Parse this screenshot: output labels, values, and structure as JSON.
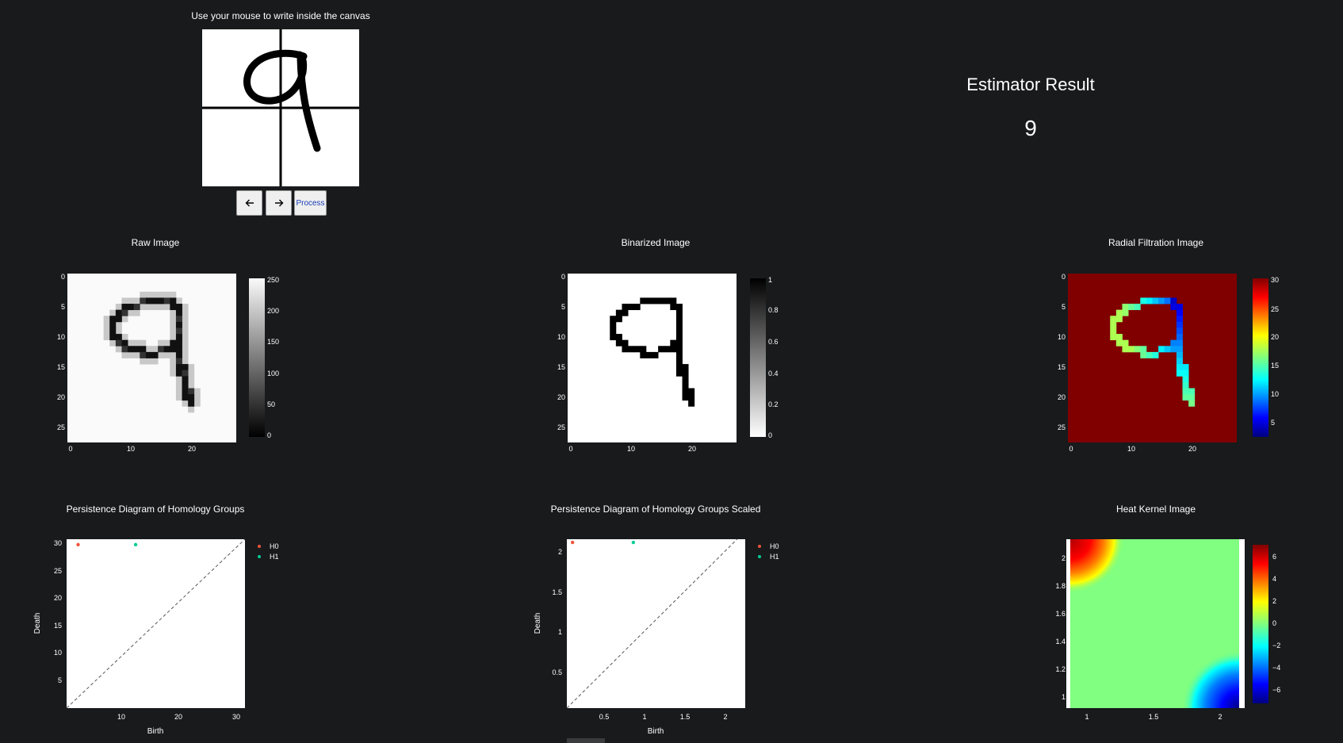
{
  "canvas": {
    "caption": "Use your mouse to write inside the canvas",
    "drawn_digit": "9"
  },
  "controls": {
    "undo_icon": "arrow-left-icon",
    "redo_icon": "arrow-right-icon",
    "process_label": "Process"
  },
  "estimator": {
    "title": "Estimator Result",
    "value": "9"
  },
  "colors": {
    "page_bg": "#181a1c",
    "h0": "#ef553b",
    "h1": "#00cc96",
    "jet_dark_red": "#800000"
  },
  "plots": {
    "raw": {
      "title": "Raw Image",
      "x_ticks": [
        "0",
        "10",
        "20"
      ],
      "y_ticks": [
        "0",
        "5",
        "10",
        "15",
        "20",
        "25"
      ],
      "colorbar_ticks": [
        "250",
        "200",
        "150",
        "100",
        "50",
        "0"
      ]
    },
    "binarized": {
      "title": "Binarized Image",
      "x_ticks": [
        "0",
        "10",
        "20"
      ],
      "y_ticks": [
        "0",
        "5",
        "10",
        "15",
        "20",
        "25"
      ],
      "colorbar_ticks": [
        "1",
        "0.8",
        "0.6",
        "0.4",
        "0.2",
        "0"
      ]
    },
    "radial": {
      "title": "Radial Filtration Image",
      "x_ticks": [
        "0",
        "10",
        "20"
      ],
      "y_ticks": [
        "0",
        "5",
        "10",
        "15",
        "20",
        "25"
      ],
      "colorbar_ticks": [
        "30",
        "25",
        "20",
        "15",
        "10",
        "5"
      ]
    },
    "persistence": {
      "title": "Persistence Diagram of Homology Groups",
      "x_ticks": [
        "10",
        "20",
        "30"
      ],
      "y_ticks": [
        "30",
        "25",
        "20",
        "15",
        "10",
        "5"
      ],
      "xlabel": "Birth",
      "ylabel": "Death",
      "legend": [
        "H0",
        "H1"
      ]
    },
    "persistence_scaled": {
      "title": "Persistence Diagram of Homology Groups Scaled",
      "x_ticks": [
        "0.5",
        "1",
        "1.5",
        "2"
      ],
      "y_ticks": [
        "2",
        "1.5",
        "1",
        "0.5"
      ],
      "xlabel": "Birth",
      "ylabel": "Death",
      "legend": [
        "H0",
        "H1"
      ]
    },
    "heat": {
      "title": "Heat Kernel Image",
      "x_ticks": [
        "1",
        "1.5",
        "2"
      ],
      "y_ticks": [
        "2",
        "1.8",
        "1.6",
        "1.4",
        "1.2",
        "1"
      ],
      "colorbar_ticks": [
        "6",
        "4",
        "2",
        "0",
        "−2",
        "−4",
        "−6"
      ]
    }
  },
  "chart_data": [
    {
      "type": "heatmap",
      "title": "Raw Image",
      "x_range": [
        0,
        27
      ],
      "y_range": [
        0,
        27
      ],
      "colorscale": "greys",
      "z_range": [
        0,
        255
      ],
      "digit": "9"
    },
    {
      "type": "heatmap",
      "title": "Binarized Image",
      "x_range": [
        0,
        27
      ],
      "y_range": [
        0,
        27
      ],
      "colorscale": "greys",
      "z_range": [
        0,
        1
      ],
      "digit": "9"
    },
    {
      "type": "heatmap",
      "title": "Radial Filtration Image",
      "x_range": [
        0,
        27
      ],
      "y_range": [
        0,
        27
      ],
      "colorscale": "jet",
      "z_range": [
        2,
        30
      ],
      "digit": "9"
    },
    {
      "type": "scatter",
      "title": "Persistence Diagram of Homology Groups",
      "xlabel": "Birth",
      "ylabel": "Death",
      "xlim": [
        0,
        31
      ],
      "ylim": [
        0,
        31
      ],
      "series": [
        {
          "name": "H0",
          "points": [
            [
              2,
              30
            ]
          ]
        },
        {
          "name": "H1",
          "points": [
            [
              12,
              30
            ]
          ]
        }
      ]
    },
    {
      "type": "scatter",
      "title": "Persistence Diagram of Homology Groups Scaled",
      "xlabel": "Birth",
      "ylabel": "Death",
      "xlim": [
        0.08,
        2.28
      ],
      "ylim": [
        0.08,
        2.18
      ],
      "series": [
        {
          "name": "H0",
          "points": [
            [
              0.15,
              2.14
            ]
          ]
        },
        {
          "name": "H1",
          "points": [
            [
              0.9,
              2.14
            ]
          ]
        }
      ]
    },
    {
      "type": "heatmap",
      "title": "Heat Kernel Image",
      "x_range": [
        0.85,
        2.2
      ],
      "y_range": [
        0.88,
        2.14
      ],
      "colorscale": "jet",
      "z_range": [
        -7,
        7
      ]
    }
  ]
}
